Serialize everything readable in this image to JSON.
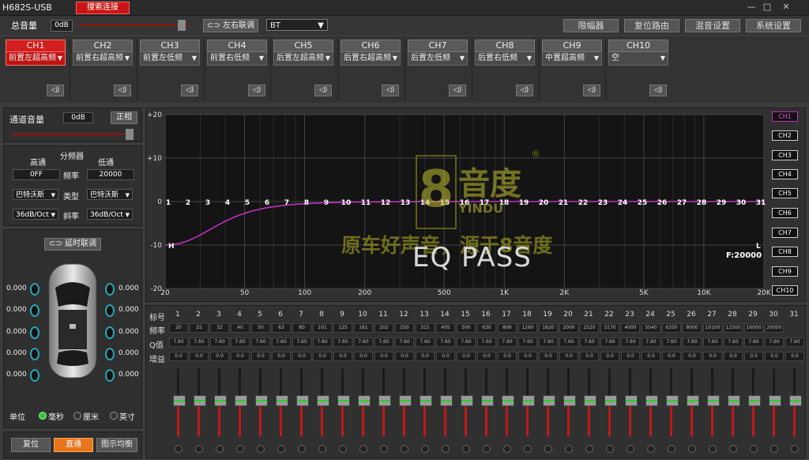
{
  "window": {
    "title": "H682S-USB",
    "search_label": "搜索连接",
    "min": "—",
    "max": "□",
    "close": "✕"
  },
  "toolbar": {
    "master_label": "总音量",
    "master_value": "0dB",
    "link_label": "左右联调",
    "input_source": "BT",
    "buttons": [
      "限幅器",
      "复位路由",
      "混音设置",
      "系统设置"
    ]
  },
  "channels": [
    {
      "name": "CH1",
      "role": "前置左超高频",
      "selected": true
    },
    {
      "name": "CH2",
      "role": "前置右超高频"
    },
    {
      "name": "CH3",
      "role": "前置左低频"
    },
    {
      "name": "CH4",
      "role": "前置右低频"
    },
    {
      "name": "CH5",
      "role": "后置左超高频"
    },
    {
      "name": "CH6",
      "role": "后置右超高频"
    },
    {
      "name": "CH7",
      "role": "后置左低频"
    },
    {
      "name": "CH8",
      "role": "后置右低频"
    },
    {
      "name": "CH9",
      "role": "中置超高频"
    },
    {
      "name": "CH10",
      "role": "空"
    }
  ],
  "speaker_icon": "speaker-icon",
  "channel_volume": {
    "label": "通道音量",
    "value": "0dB",
    "phase_label": "正相"
  },
  "crossover": {
    "title": "分频器",
    "high_label": "高通",
    "low_label": "低通",
    "freq_label": "频率",
    "type_label": "类型",
    "slope_label": "斜率",
    "high_freq": "0FF",
    "low_freq": "20000",
    "high_type": "巴特沃斯",
    "low_type": "巴特沃斯",
    "high_slope": "36dB/Oct",
    "low_slope": "36dB/Oct"
  },
  "delay": {
    "link_label": "延时联调",
    "values_left": [
      "0.000",
      "0.000",
      "0.000",
      "0.000",
      "0.000"
    ],
    "values_right": [
      "0.000",
      "0.000",
      "0.000",
      "0.000",
      "0.000"
    ],
    "unit_label": "单位",
    "units": [
      "毫秒",
      "厘米",
      "英寸"
    ],
    "unit_selected": 0
  },
  "bottom_buttons": [
    "复位",
    "直通",
    "图示均衡"
  ],
  "eq": {
    "y_ticks": [
      "+20",
      "+10",
      "0",
      "-10",
      "-20"
    ],
    "x_ticks": [
      "20",
      "50",
      "100",
      "200",
      "500",
      "1K",
      "2K",
      "5K",
      "10K",
      "20K"
    ],
    "band_markers": [
      "1",
      "2",
      "3",
      "4",
      "5",
      "6",
      "7",
      "8",
      "9",
      "10",
      "11",
      "12",
      "13",
      "14",
      "15",
      "16",
      "17",
      "18",
      "19",
      "20",
      "21",
      "22",
      "23",
      "24",
      "25",
      "26",
      "27",
      "28",
      "29",
      "30",
      "31"
    ],
    "h_marker": "H",
    "l_marker": "L",
    "status": "EQ PASS",
    "freq_readout": "F:20000",
    "logo_text": "音度",
    "logo_sub": "YINDU",
    "logo_slogan": "原车好声音，源于8音度",
    "legend": [
      "CH1",
      "CH2",
      "CH3",
      "CH4",
      "CH5",
      "CH6",
      "CH7",
      "CH8",
      "CH9",
      "CH10"
    ]
  },
  "bands": {
    "labels": {
      "num": "标号",
      "freq": "频率",
      "q": "Q值",
      "gain": "增益"
    },
    "freq": [
      "20",
      "25",
      "32",
      "40",
      "50",
      "63",
      "80",
      "101",
      "125",
      "161",
      "202",
      "250",
      "315",
      "405",
      "500",
      "630",
      "809",
      "1260",
      "1620",
      "2000",
      "2520",
      "3170",
      "4000",
      "5040",
      "6350",
      "8000",
      "10100",
      "12500",
      "16000",
      "20000"
    ],
    "q": "7.60",
    "gain": "0.0",
    "count": 31
  },
  "colors": {
    "accent": "#d21e1e",
    "curve": "#c030c0",
    "speaker": "#29a6b8"
  }
}
